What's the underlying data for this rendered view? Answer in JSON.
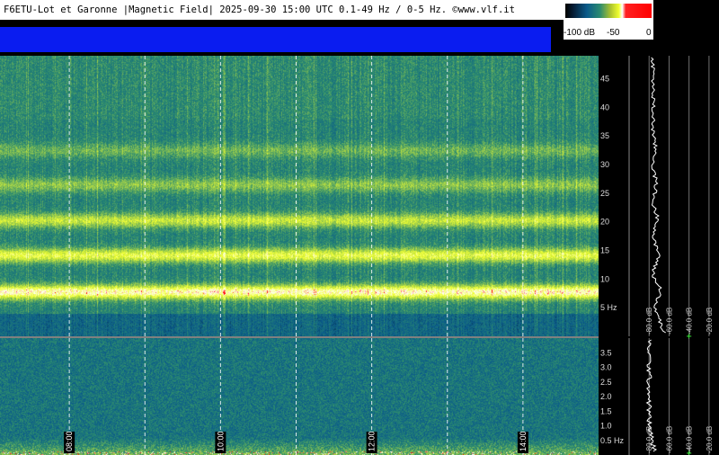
{
  "header": {
    "title": "F6ETU-Lot et Garonne |Magnetic Field| 2025-09-30 15:00 UTC 0.1-49 Hz / 0-5 Hz. ©www.vlf.it",
    "colorbar_labels": [
      "-100 dB",
      "-50",
      "0"
    ]
  },
  "colors": {
    "background": "#000000",
    "header_band": "#0a1cf0",
    "colormap": [
      "#000000",
      "#0a5a8a",
      "#2a8a70",
      "#f0ff30",
      "#ffffff",
      "#ff0000"
    ],
    "spectrogram_base": "#1d4a5a",
    "band_highlight": "#f0ff40",
    "profile_trace": "#ffffff",
    "grid": "#ffffff"
  },
  "chart_data": [
    {
      "type": "heatmap",
      "title": "",
      "xlabel": "",
      "ylabel": "",
      "y_unit": "Hz",
      "ylim": [
        0,
        49
      ],
      "y_ticks": [
        {
          "value": 5,
          "label": "5 Hz"
        },
        {
          "value": 10,
          "label": "10"
        },
        {
          "value": 15,
          "label": "15"
        },
        {
          "value": 20,
          "label": "20"
        },
        {
          "value": 25,
          "label": "25"
        },
        {
          "value": 30,
          "label": "30"
        },
        {
          "value": 35,
          "label": "35"
        },
        {
          "value": 40,
          "label": "40"
        },
        {
          "value": 45,
          "label": "45"
        }
      ],
      "time_range": [
        "07:05",
        "15:00"
      ],
      "time_gridlines": [
        "08:00",
        "09:00",
        "10:00",
        "11:00",
        "12:00",
        "13:00",
        "14:00"
      ],
      "intensity_bands_hz": [
        {
          "freq": 7.8,
          "strength": 1.0
        },
        {
          "freq": 14.2,
          "strength": 0.75
        },
        {
          "freq": 20.3,
          "strength": 0.6
        },
        {
          "freq": 26.5,
          "strength": 0.4
        },
        {
          "freq": 32.5,
          "strength": 0.3
        }
      ],
      "grid": true
    },
    {
      "type": "heatmap",
      "title": "",
      "xlabel": "",
      "ylabel": "",
      "y_unit": "Hz",
      "ylim": [
        0,
        4
      ],
      "y_ticks": [
        {
          "value": 0.5,
          "label": "0.5 Hz"
        },
        {
          "value": 1.0,
          "label": "1.0"
        },
        {
          "value": 1.5,
          "label": "1.5"
        },
        {
          "value": 2.0,
          "label": "2.0"
        },
        {
          "value": 2.5,
          "label": "2.5"
        },
        {
          "value": 3.0,
          "label": "3.0"
        },
        {
          "value": 3.5,
          "label": "3.5"
        }
      ],
      "time_labels": [
        "08:00",
        "10:00",
        "12:00",
        "14:00"
      ],
      "time_gridlines": [
        "08:00",
        "09:00",
        "10:00",
        "11:00",
        "12:00",
        "13:00",
        "14:00"
      ],
      "grid": true
    },
    {
      "type": "line",
      "title": "",
      "xlabel": "",
      "ylabel": "",
      "x_unit": "dB",
      "xlim": [
        -100,
        -10
      ],
      "x_tick_labels": [
        "-80.0 dB",
        "-60.0 dB",
        "-40.0 dB",
        "-20.0 dB"
      ],
      "x_tick_values": [
        -80,
        -60,
        -40,
        -20
      ],
      "peaks_hz": [
        7.8,
        14.2,
        20.3
      ],
      "grid": true
    }
  ]
}
